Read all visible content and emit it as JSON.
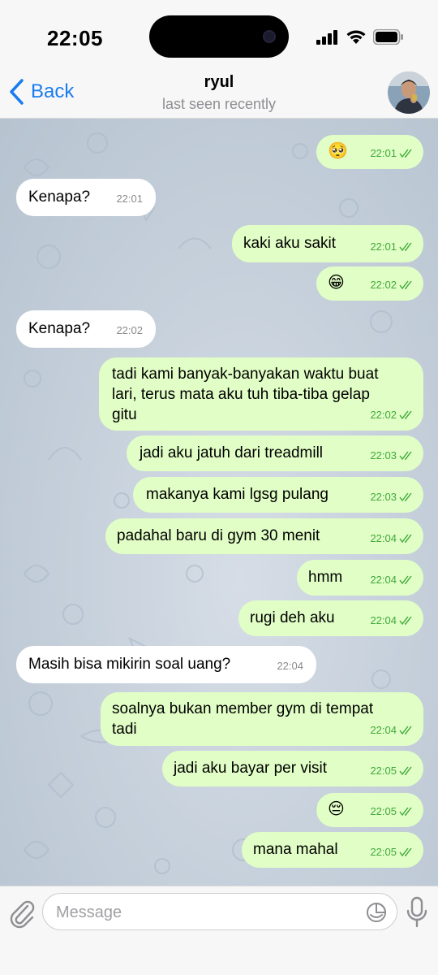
{
  "status": {
    "time": "22:05"
  },
  "header": {
    "back_label": "Back",
    "title": "ryul",
    "subtitle": "last seen recently"
  },
  "messages": [
    {
      "dir": "out",
      "emoji": "🥺",
      "time": "22:01"
    },
    {
      "dir": "in",
      "text": "Kenapa?",
      "time": "22:01"
    },
    {
      "dir": "out",
      "text": "kaki aku sakit",
      "time": "22:01"
    },
    {
      "dir": "out",
      "emoji": "😁",
      "time": "22:02"
    },
    {
      "dir": "in",
      "text": "Kenapa?",
      "time": "22:02"
    },
    {
      "dir": "out",
      "lines": [
        "tadi kami banyak-banyakan waktu buat",
        "lari, terus mata aku tuh tiba-tiba gelap",
        "gitu"
      ],
      "time": "22:02"
    },
    {
      "dir": "out",
      "text": "jadi aku jatuh dari treadmill",
      "time": "22:03"
    },
    {
      "dir": "out",
      "text": "makanya kami lgsg pulang",
      "time": "22:03"
    },
    {
      "dir": "out",
      "text": "padahal baru di gym 30 menit",
      "time": "22:04"
    },
    {
      "dir": "out",
      "text": "hmm",
      "time": "22:04"
    },
    {
      "dir": "out",
      "text": "rugi deh aku",
      "time": "22:04"
    },
    {
      "dir": "in",
      "text": "Masih bisa mikirin soal uang?",
      "time": "22:04"
    },
    {
      "dir": "out",
      "lines": [
        "soalnya bukan member gym di tempat",
        "tadi"
      ],
      "time": "22:04"
    },
    {
      "dir": "out",
      "text": "jadi aku bayar per visit",
      "time": "22:05"
    },
    {
      "dir": "out",
      "emoji": "😔",
      "time": "22:05"
    },
    {
      "dir": "out",
      "text": "mana mahal",
      "time": "22:05"
    }
  ],
  "composer": {
    "placeholder": "Message"
  },
  "colors": {
    "accent": "#1a7cf0",
    "outgoing_bubble": "#e1fec6",
    "incoming_bubble": "#ffffff",
    "read_check": "#3fa93a"
  },
  "icons": [
    "back-chevron-icon",
    "signal-icon",
    "wifi-icon",
    "battery-icon",
    "double-check-icon",
    "paperclip-icon",
    "sticker-icon",
    "microphone-icon"
  ]
}
